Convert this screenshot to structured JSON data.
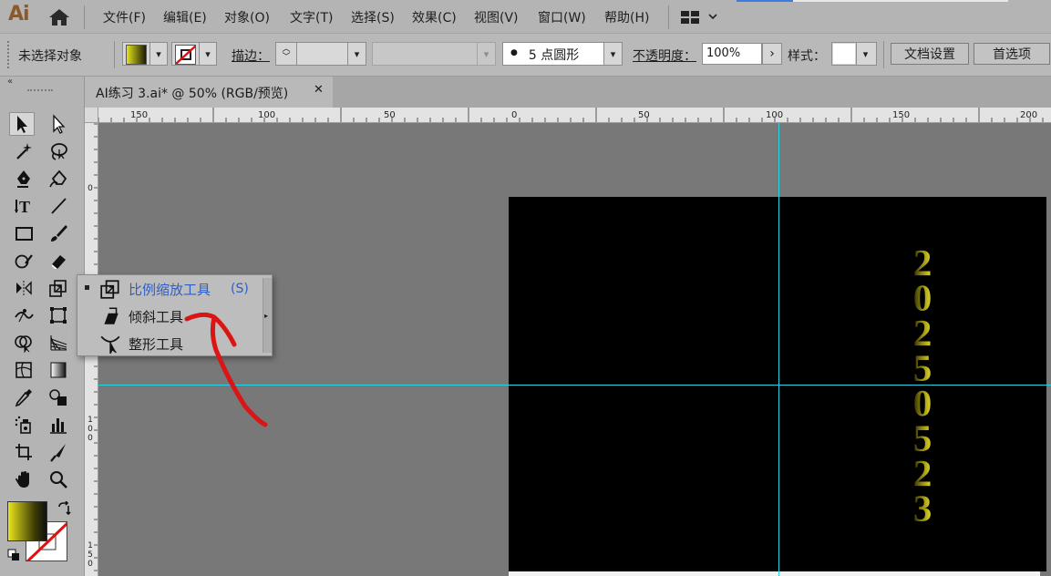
{
  "app": {
    "logo": "Ai"
  },
  "menu": {
    "items": [
      "文件(F)",
      "编辑(E)",
      "对象(O)",
      "文字(T)",
      "选择(S)",
      "效果(C)",
      "视图(V)",
      "窗口(W)",
      "帮助(H)"
    ]
  },
  "controlbar": {
    "selection_status": "未选择对象",
    "stroke_label": "描边：",
    "stroke_value": "",
    "brush_bullet": "●",
    "brush_size": "5 点圆形",
    "opacity_label": "不透明度：",
    "opacity_value": "100%",
    "style_label": "样式：",
    "doc_setup_button": "文档设置",
    "preferences_button": "首选项"
  },
  "document_tab": {
    "title": "AI练习 3.ai* @ 50% (RGB/预览)",
    "close_glyph": "✕"
  },
  "ruler": {
    "horizontal": [
      "150",
      "100",
      "50",
      "0",
      "50",
      "100",
      "150",
      "200"
    ],
    "vertical": [
      [
        "0"
      ],
      [
        "1",
        "0",
        "0"
      ],
      [
        "1",
        "5",
        "0"
      ]
    ]
  },
  "flyout": {
    "items": [
      {
        "label": "比例缩放工具",
        "shortcut": "(S)",
        "selected": true
      },
      {
        "label": "倾斜工具",
        "shortcut": "",
        "selected": false
      },
      {
        "label": "整形工具",
        "shortcut": "",
        "selected": false
      }
    ]
  },
  "artwork": {
    "text": "20250523"
  },
  "colors": {
    "accent_blue": "#2f5fc4",
    "guide_cyan": "#29d3e8",
    "annotation_red": "#d91515",
    "text_gold": "#d6cc1a"
  }
}
